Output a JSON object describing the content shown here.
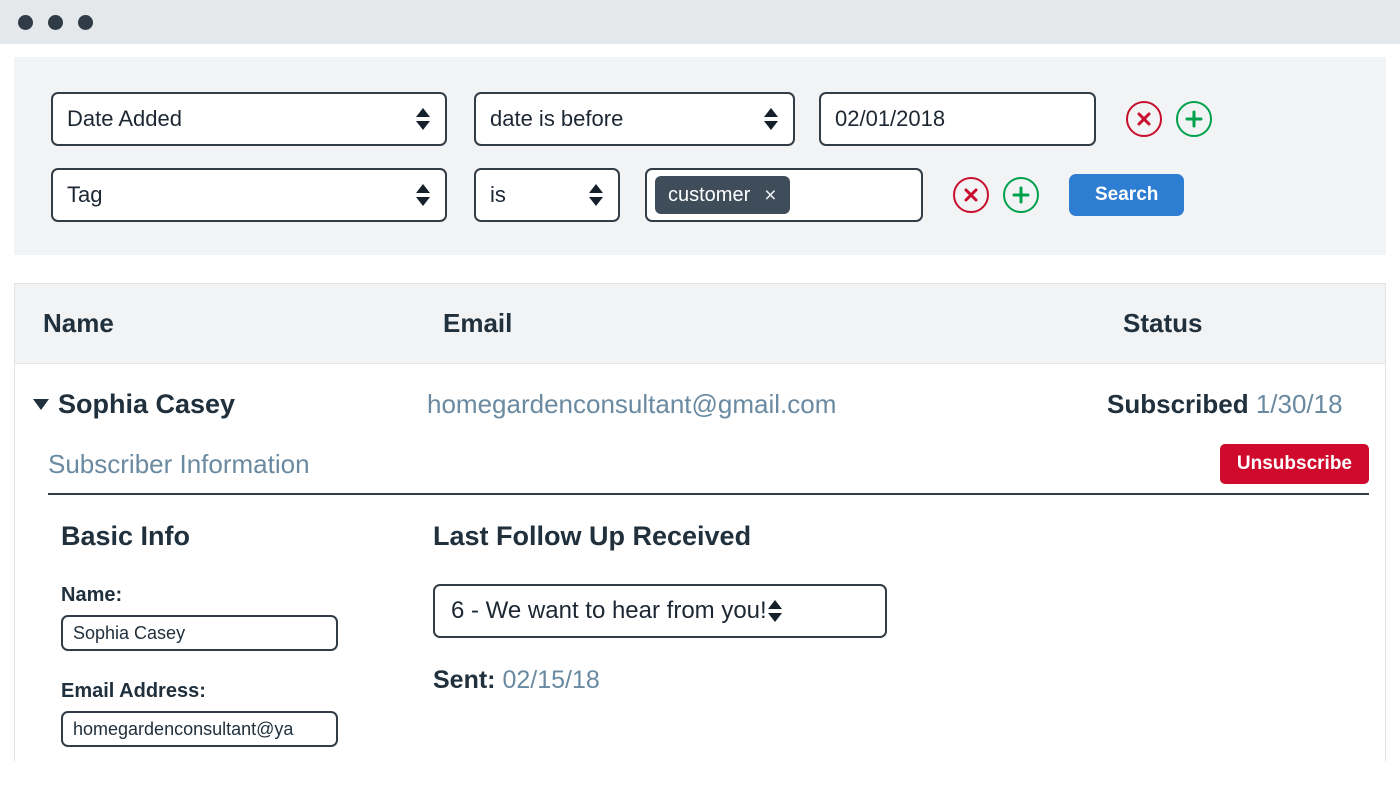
{
  "window": {
    "traffic_lights": [
      "close-dot",
      "minimize-dot",
      "maximize-dot"
    ]
  },
  "filters": {
    "rows": [
      {
        "field": "Date Added",
        "operator": "date is before",
        "value": "02/01/2018",
        "remove_icon": "circle-x-icon",
        "add_icon": "circle-plus-icon"
      },
      {
        "field": "Tag",
        "operator": "is",
        "chip": "customer",
        "chip_remove": "×",
        "remove_icon": "circle-x-icon",
        "add_icon": "circle-plus-icon"
      }
    ],
    "search_label": "Search",
    "accent_blue": "#2d7dd2",
    "remove_red": "#c8102e",
    "add_green": "#00a14b",
    "chip_bg": "#3f4c59"
  },
  "table": {
    "columns": [
      "Name",
      "Email",
      "Status"
    ],
    "row": {
      "expander": "caret-down-icon",
      "name": "Sophia Casey",
      "email": "homegardenconsultant@gmail.com",
      "status_label": "Subscribed",
      "status_date": "1/30/18"
    }
  },
  "detail": {
    "title": "Subscriber Information",
    "unsubscribe_label": "Unsubscribe",
    "unsubscribe_color": "#cf0a2c",
    "link_color": "#6a8aa1",
    "basic": {
      "heading": "Basic Info",
      "fields": [
        {
          "label": "Name:",
          "value": "Sophia Casey"
        },
        {
          "label": "Email Address:",
          "value": "homegardenconsultant@ya"
        }
      ]
    },
    "follow_up": {
      "heading": "Last Follow Up Received",
      "selected": "6 - We want to hear from you!",
      "sent_label": "Sent:",
      "sent_date": "02/15/18"
    }
  }
}
